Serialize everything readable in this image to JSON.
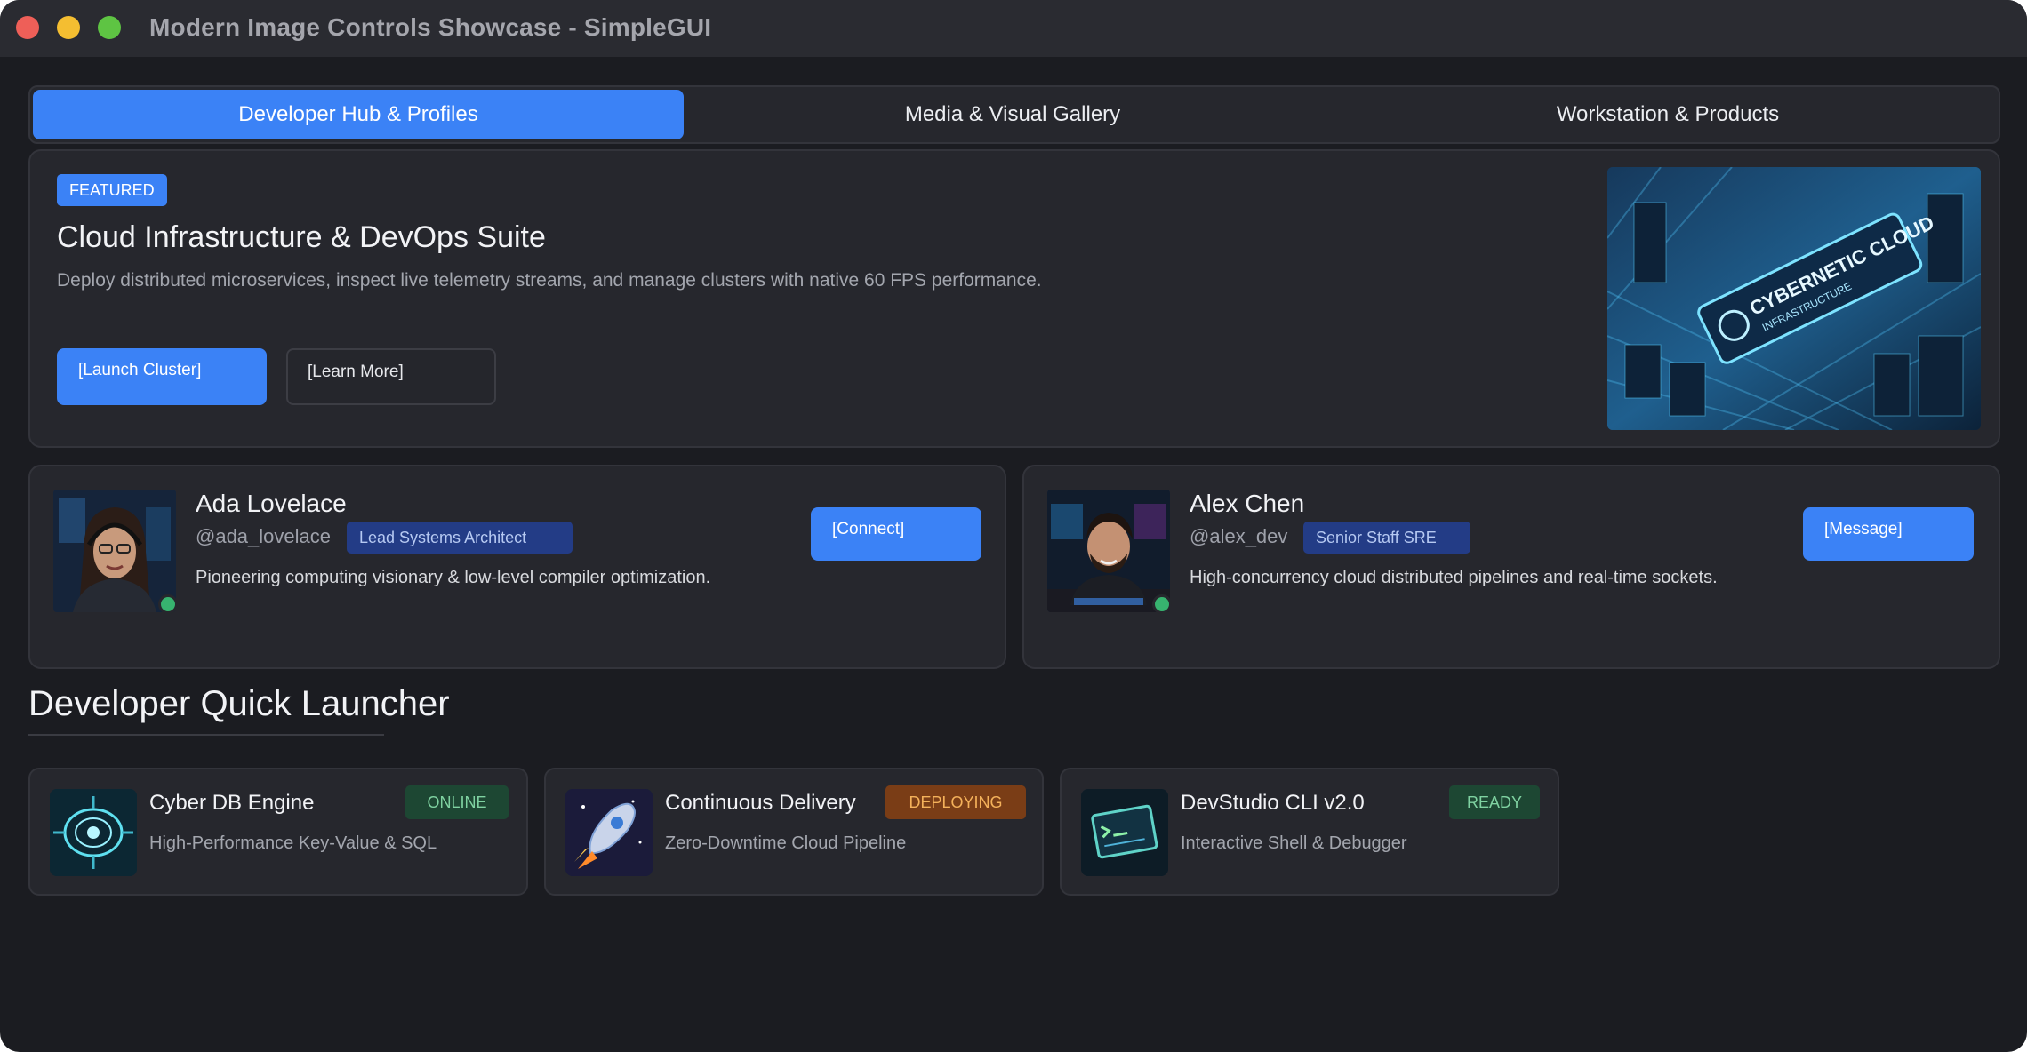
{
  "window": {
    "title": "Modern Image Controls Showcase - SimpleGUI"
  },
  "tabs": [
    {
      "label": "Developer Hub & Profiles",
      "active": true
    },
    {
      "label": "Media & Visual Gallery",
      "active": false
    },
    {
      "label": "Workstation & Products",
      "active": false
    }
  ],
  "hero": {
    "badge": "FEATURED",
    "title": "Cloud Infrastructure & DevOps Suite",
    "description": "Deploy distributed microservices, inspect live telemetry streams, and manage clusters with native 60 FPS performance.",
    "primary_button": "[Launch Cluster]",
    "secondary_button": "[Learn More]",
    "image_caption": "CYBERNETIC CLOUD",
    "image_subcaption": "INFRASTRUCTURE"
  },
  "profiles": [
    {
      "name": "Ada Lovelace",
      "handle": "@ada_lovelace",
      "role": "Lead Systems Architect",
      "description": "Pioneering computing visionary & low-level compiler optimization.",
      "button": "[Connect]",
      "status": "online"
    },
    {
      "name": "Alex Chen",
      "handle": "@alex_dev",
      "role": "Senior Staff SRE",
      "description": "High-concurrency cloud distributed pipelines and real-time sockets.",
      "button": "[Message]",
      "status": "online"
    }
  ],
  "launcher": {
    "title": "Developer Quick Launcher",
    "items": [
      {
        "title": "Cyber DB Engine",
        "subtitle": "High-Performance Key-Value & SQL",
        "status": "ONLINE",
        "icon": "database-engine-icon"
      },
      {
        "title": "Continuous Delivery",
        "subtitle": "Zero-Downtime Cloud Pipeline",
        "status": "DEPLOYING",
        "icon": "rocket-icon"
      },
      {
        "title": "DevStudio CLI v2.0",
        "subtitle": "Interactive Shell & Debugger",
        "status": "READY",
        "icon": "terminal-icon"
      }
    ]
  },
  "colors": {
    "window_bg": "#1b1c21",
    "card_bg": "#26272d",
    "accent": "#3b82f6",
    "status_online": "#7fd2a1",
    "status_deploying": "#f4b15a",
    "presence_online": "#37b36f"
  }
}
